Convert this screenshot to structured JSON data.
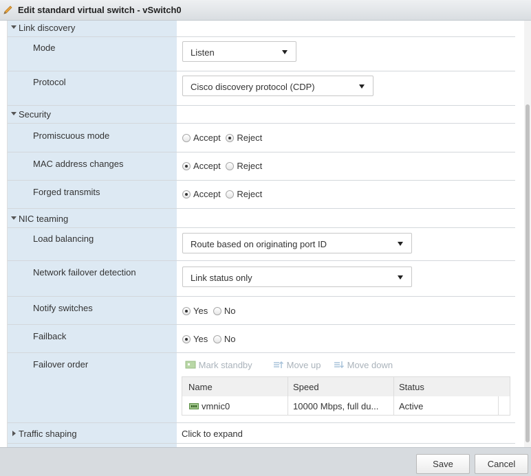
{
  "window": {
    "title": "Edit standard virtual switch - vSwitch0",
    "icon": "pencil-icon"
  },
  "sections": {
    "link_discovery": {
      "label": "Link discovery",
      "mode": {
        "label": "Mode",
        "value": "Listen"
      },
      "protocol": {
        "label": "Protocol",
        "value": "Cisco discovery protocol (CDP)"
      }
    },
    "security": {
      "label": "Security",
      "promiscuous": {
        "label": "Promiscuous mode",
        "opt1": "Accept",
        "opt2": "Reject",
        "selected": "Reject"
      },
      "mac_changes": {
        "label": "MAC address changes",
        "opt1": "Accept",
        "opt2": "Reject",
        "selected": "Accept"
      },
      "forged": {
        "label": "Forged transmits",
        "opt1": "Accept",
        "opt2": "Reject",
        "selected": "Accept"
      }
    },
    "nic_teaming": {
      "label": "NIC teaming",
      "load_balancing": {
        "label": "Load balancing",
        "value": "Route based on originating port ID"
      },
      "failover_detection": {
        "label": "Network failover detection",
        "value": "Link status only"
      },
      "notify": {
        "label": "Notify switches",
        "opt1": "Yes",
        "opt2": "No",
        "selected": "Yes"
      },
      "failback": {
        "label": "Failback",
        "opt1": "Yes",
        "opt2": "No",
        "selected": "Yes"
      },
      "failover_order": {
        "label": "Failover order",
        "toolbar": {
          "mark_standby": "Mark standby",
          "move_up": "Move up",
          "move_down": "Move down"
        },
        "columns": [
          "Name",
          "Speed",
          "Status"
        ],
        "rows": [
          {
            "name": "vmnic0",
            "speed": "10000 Mbps, full du...",
            "status": "Active"
          }
        ]
      }
    },
    "traffic_shaping": {
      "label": "Traffic shaping",
      "value": "Click to expand"
    }
  },
  "footer": {
    "save": "Save",
    "cancel": "Cancel"
  },
  "colors": {
    "label_column": "#dde9f3",
    "titlebar": "#d9dde1",
    "footer": "#d7dbdf"
  }
}
